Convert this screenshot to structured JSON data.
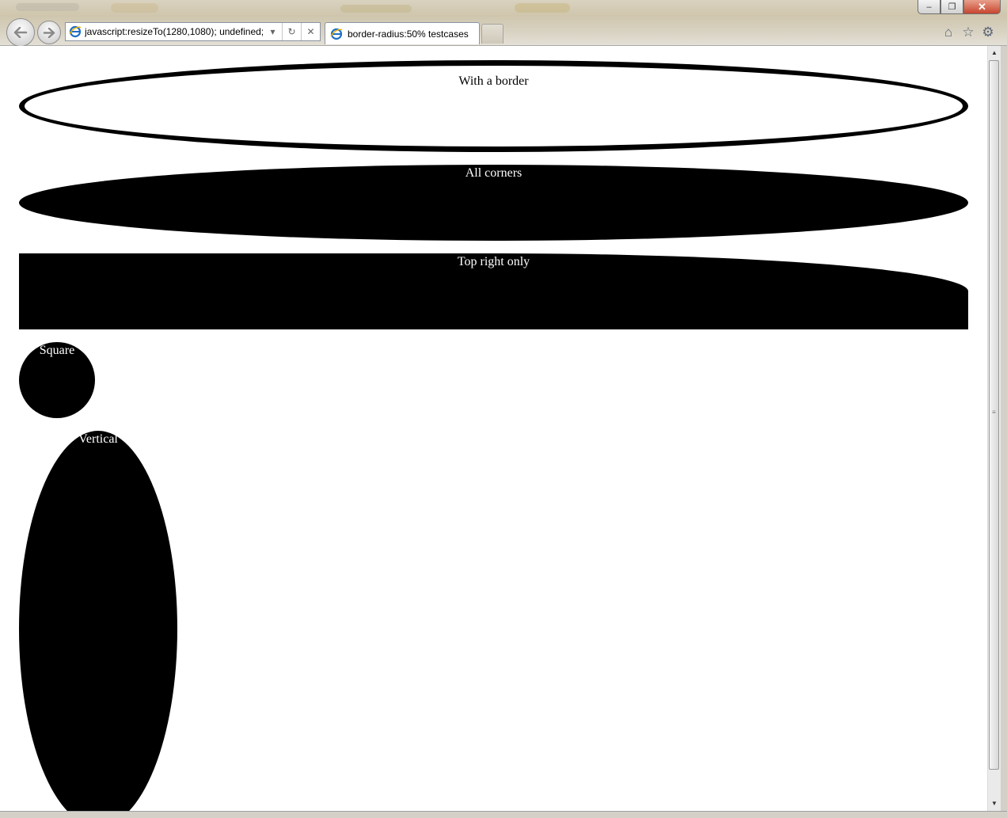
{
  "window": {
    "controls": {
      "minimize": "‒",
      "restore": "❐",
      "close": "✕"
    }
  },
  "nav": {
    "back_icon": "arrow-left-icon",
    "forward_icon": "arrow-right-icon"
  },
  "address_bar": {
    "value": "javascript:resizeTo(1280,1080); undefined;",
    "dropdown_glyph": "▾",
    "refresh_glyph": "↻",
    "stop_glyph": "✕"
  },
  "tab": {
    "title": "border-radius:50% testcases"
  },
  "toolbar": {
    "home_glyph": "⌂",
    "favorites_glyph": "☆",
    "tools_glyph": "⚙"
  },
  "page": {
    "shapes": [
      {
        "label": "With a border"
      },
      {
        "label": "All corners"
      },
      {
        "label": "Top right only"
      },
      {
        "label": "Square"
      },
      {
        "label": "Vertical"
      }
    ]
  },
  "scrollbar": {
    "up_glyph": "▲",
    "down_glyph": "▼",
    "grip_glyph": "≡"
  },
  "colors": {
    "shape_fill": "#000000",
    "page_background": "#ffffff",
    "label_on_dark": "#ffffff"
  }
}
